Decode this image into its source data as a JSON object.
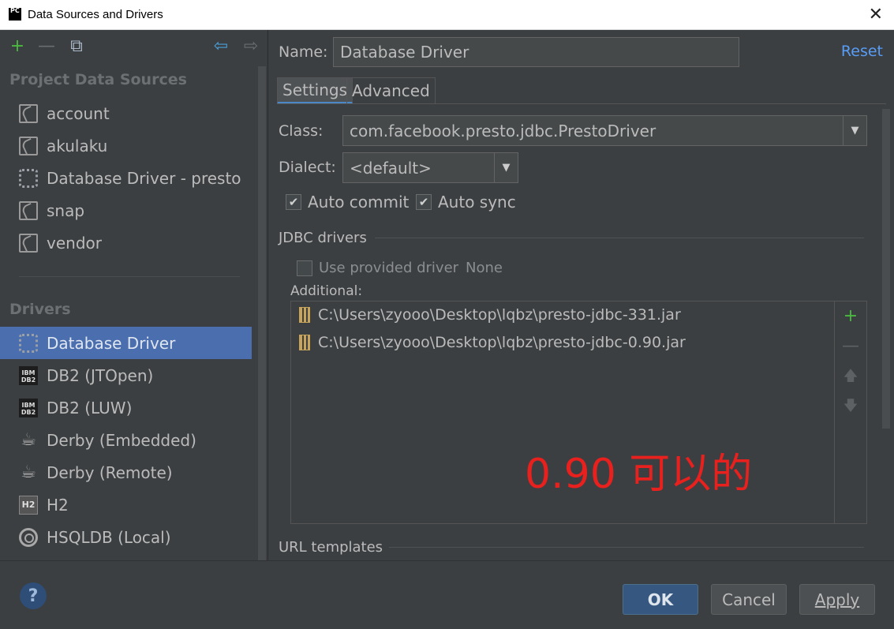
{
  "window": {
    "app_icon": "PC",
    "title": "Data Sources and Drivers",
    "close_label": "✕"
  },
  "left": {
    "toolbar": [
      {
        "icon": "plus-icon",
        "glyph": "+",
        "color": "#4ab93e"
      },
      {
        "icon": "minus-icon",
        "glyph": "—",
        "color": "#6a6d70"
      },
      {
        "icon": "duplicate-icon",
        "glyph": "⧉",
        "color": "#a9b7c6"
      },
      {
        "icon": "back-arrow-icon",
        "glyph": "⇦",
        "color": "#4a9fd8"
      },
      {
        "icon": "forward-arrow-icon",
        "glyph": "⇨",
        "color": "#6a6d70"
      }
    ],
    "project_title": "Project Data Sources",
    "project_items": [
      {
        "label": "account",
        "icon": "datasource-icon"
      },
      {
        "label": "akulaku",
        "icon": "datasource-icon"
      },
      {
        "label": "Database Driver - presto",
        "icon": "driver-icon"
      },
      {
        "label": "snap",
        "icon": "datasource-icon"
      },
      {
        "label": "vendor",
        "icon": "datasource-icon"
      }
    ],
    "drivers_title": "Drivers",
    "driver_items": [
      {
        "label": "Database Driver",
        "icon": "driver-icon",
        "selected": true
      },
      {
        "label": "DB2 (JTOpen)",
        "icon": "ibm-db2-icon"
      },
      {
        "label": "DB2 (LUW)",
        "icon": "ibm-db2-icon"
      },
      {
        "label": "Derby (Embedded)",
        "icon": "derby-hat-icon"
      },
      {
        "label": "Derby (Remote)",
        "icon": "derby-hat-icon"
      },
      {
        "label": "H2",
        "icon": "h2-icon"
      },
      {
        "label": "HSQLDB (Local)",
        "icon": "hsqldb-icon"
      }
    ]
  },
  "right": {
    "name_label": "Name:",
    "name_value": "Database Driver",
    "reset_label": "Reset",
    "tabs": [
      {
        "label": "Settings",
        "active": true
      },
      {
        "label": "Advanced",
        "active": false
      }
    ],
    "class_label": "Class:",
    "class_value": "com.facebook.presto.jdbc.PrestoDriver",
    "dialect_label": "Dialect:",
    "dialect_value": "<default>",
    "auto_commit_label": "Auto commit",
    "auto_commit_checked": true,
    "auto_sync_label": "Auto sync",
    "auto_sync_checked": true,
    "jdbc_title": "JDBC drivers",
    "use_provided_label": "Use provided driver",
    "use_provided_value": "None",
    "use_provided_checked": false,
    "additional_label": "Additional:",
    "jars": [
      "C:\\Users\\zyooo\\Desktop\\lqbz\\presto-jdbc-331.jar",
      "C:\\Users\\zyooo\\Desktop\\lqbz\\presto-jdbc-0.90.jar"
    ],
    "annotation": "0.90 可以的",
    "url_title": "URL templates"
  },
  "footer": {
    "help_label": "?",
    "ok_label": "OK",
    "cancel_label": "Cancel",
    "apply_label": "Apply"
  },
  "colors": {
    "background": "#3c3f41",
    "selection": "#4b6eaf",
    "link": "#589df6",
    "add": "#4ab93e",
    "annotation": "#e8201e"
  }
}
